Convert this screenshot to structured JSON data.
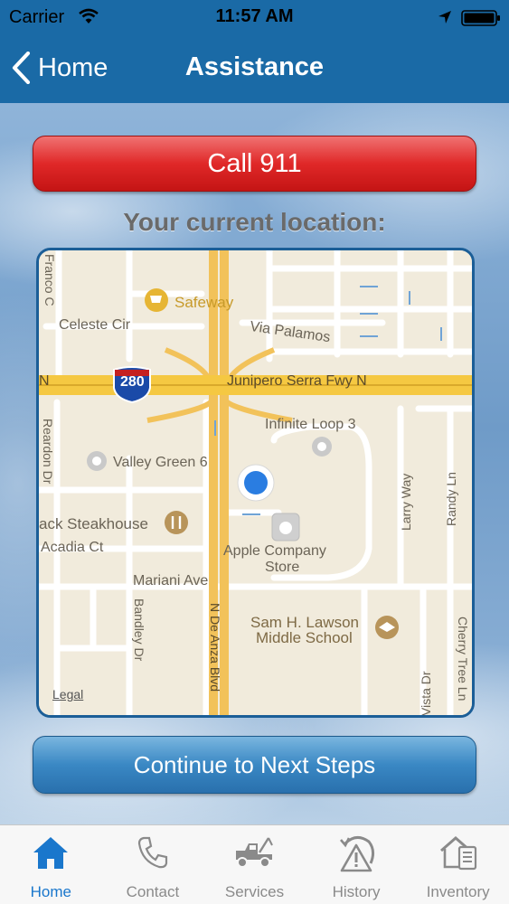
{
  "status_bar": {
    "carrier": "Carrier",
    "time": "11:57 AM"
  },
  "nav": {
    "back_label": "Home",
    "title": "Assistance"
  },
  "call_button_label": "Call 911",
  "location_heading": "Your current location:",
  "map": {
    "labels": {
      "safeway": "Safeway",
      "celeste": "Celeste Cir",
      "via_palamos": "Via Palamos",
      "highway_shield": "280",
      "junipero": "Junipero Serra Fwy N",
      "highway_left": "N",
      "infinite_loop": "Infinite Loop 3",
      "valley_green": "Valley Green 6",
      "steakhouse": "ack Steakhouse",
      "acadia": "Acadia Ct",
      "apple_store_1": "Apple Company",
      "apple_store_2": "Store",
      "mariani": "Mariani Ave",
      "lawson_1": "Sam H. Lawson",
      "lawson_2": "Middle School",
      "franco": "Franco C",
      "reardon": "Reardon Dr",
      "de_anza": "N De Anza Blvd",
      "bandley": "Bandley Dr",
      "larry": "Larry Way",
      "randy": "Randy Ln",
      "vista": "Vista Dr",
      "cherry": "Cherry Tree Ln"
    },
    "legal": "Legal"
  },
  "continue_button_label": "Continue to Next Steps",
  "tabs": [
    {
      "label": "Home",
      "icon": "home-icon",
      "active": true
    },
    {
      "label": "Contact",
      "icon": "phone-icon",
      "active": false
    },
    {
      "label": "Services",
      "icon": "tow-truck-icon",
      "active": false
    },
    {
      "label": "History",
      "icon": "history-warning-icon",
      "active": false
    },
    {
      "label": "Inventory",
      "icon": "inventory-icon",
      "active": false
    }
  ],
  "colors": {
    "nav_blue": "#1a6aa6",
    "call_red": "#e02828",
    "continue_blue": "#3a88c4",
    "tab_active": "#1a77cc",
    "highway_yellow": "#f5c842",
    "location_dot": "#2a7de1"
  }
}
